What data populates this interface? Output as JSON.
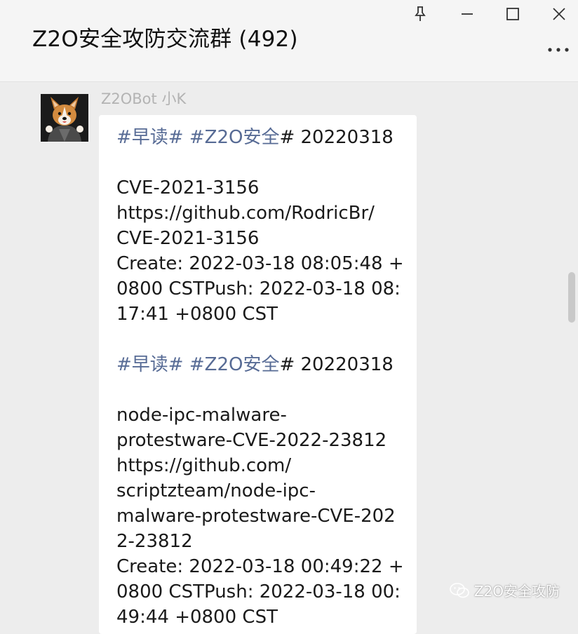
{
  "window": {
    "title": "Z2O安全攻防交流群 (492)"
  },
  "message": {
    "sender": "Z2OBot 小K",
    "block1": {
      "tag1": "#早读#",
      "tag2": "#Z2O安全",
      "after_tag": "# 20220318",
      "lines": [
        "CVE-2021-3156",
        "https://github.com/RodricBr/",
        "CVE-2021-3156",
        "Create: 2022-03-18 08:05:48 +",
        "0800 CSTPush: 2022-03-18 08:",
        "17:41 +0800 CST"
      ]
    },
    "block2": {
      "tag1": "#早读#",
      "tag2": "#Z2O安全",
      "after_tag": "# 20220318",
      "lines": [
        "node-ipc-malware-",
        "protestware-CVE-2022-23812",
        "https://github.com/",
        "scriptzteam/node-ipc-",
        "malware-protestware-CVE-202",
        "2-23812",
        "Create: 2022-03-18 00:49:22 +",
        "0800 CSTPush: 2022-03-18 00:",
        "49:44 +0800 CST"
      ]
    }
  },
  "watermark": {
    "text": "Z2O安全攻防"
  },
  "colors": {
    "tag": "#576b95",
    "bubble": "#ffffff",
    "chat_bg": "#ededed"
  }
}
